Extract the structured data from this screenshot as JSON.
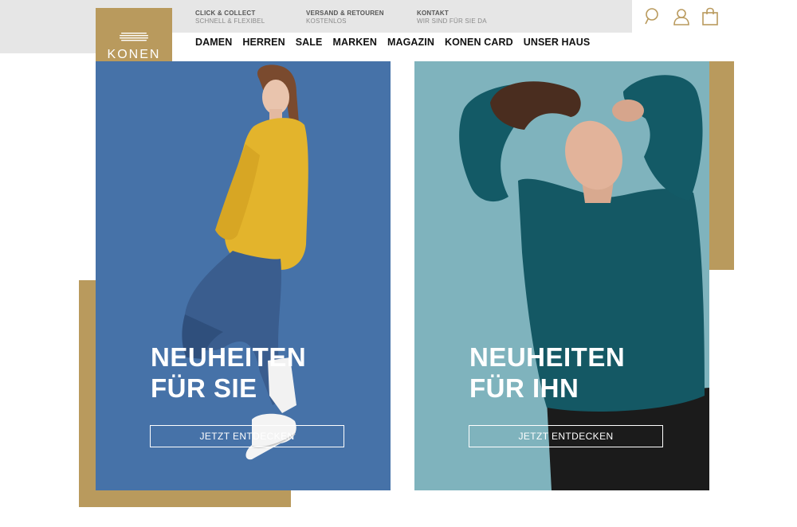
{
  "header": {
    "logo_text": "KONEN",
    "info": [
      {
        "title": "CLICK & COLLECT",
        "subtitle": "SCHNELL & FLEXIBEL"
      },
      {
        "title": "VERSAND & RETOUREN",
        "subtitle": "KOSTENLOS"
      },
      {
        "title": "KONTAKT",
        "subtitle": "WIR SIND FÜR SIE DA"
      }
    ],
    "nav": [
      "DAMEN",
      "HERREN",
      "SALE",
      "MARKEN",
      "MAGAZIN",
      "KONEN CARD",
      "UNSER HAUS"
    ],
    "icons": [
      "search-icon",
      "user-icon",
      "shopping-bag-icon"
    ]
  },
  "teasers": [
    {
      "headline_line1": "NEUHEITEN",
      "headline_line2": "FÜR SIE",
      "button": "JETZT ENTDECKEN"
    },
    {
      "headline_line1": "NEUHEITEN",
      "headline_line2": "FÜR IHN",
      "button": "JETZT ENTDECKEN"
    }
  ],
  "colors": {
    "accent_gold": "#b99a5d",
    "left_panel_bg": "#4672a8",
    "right_panel_bg": "#7fb3bd",
    "topbar_bg": "#e6e6e6"
  }
}
